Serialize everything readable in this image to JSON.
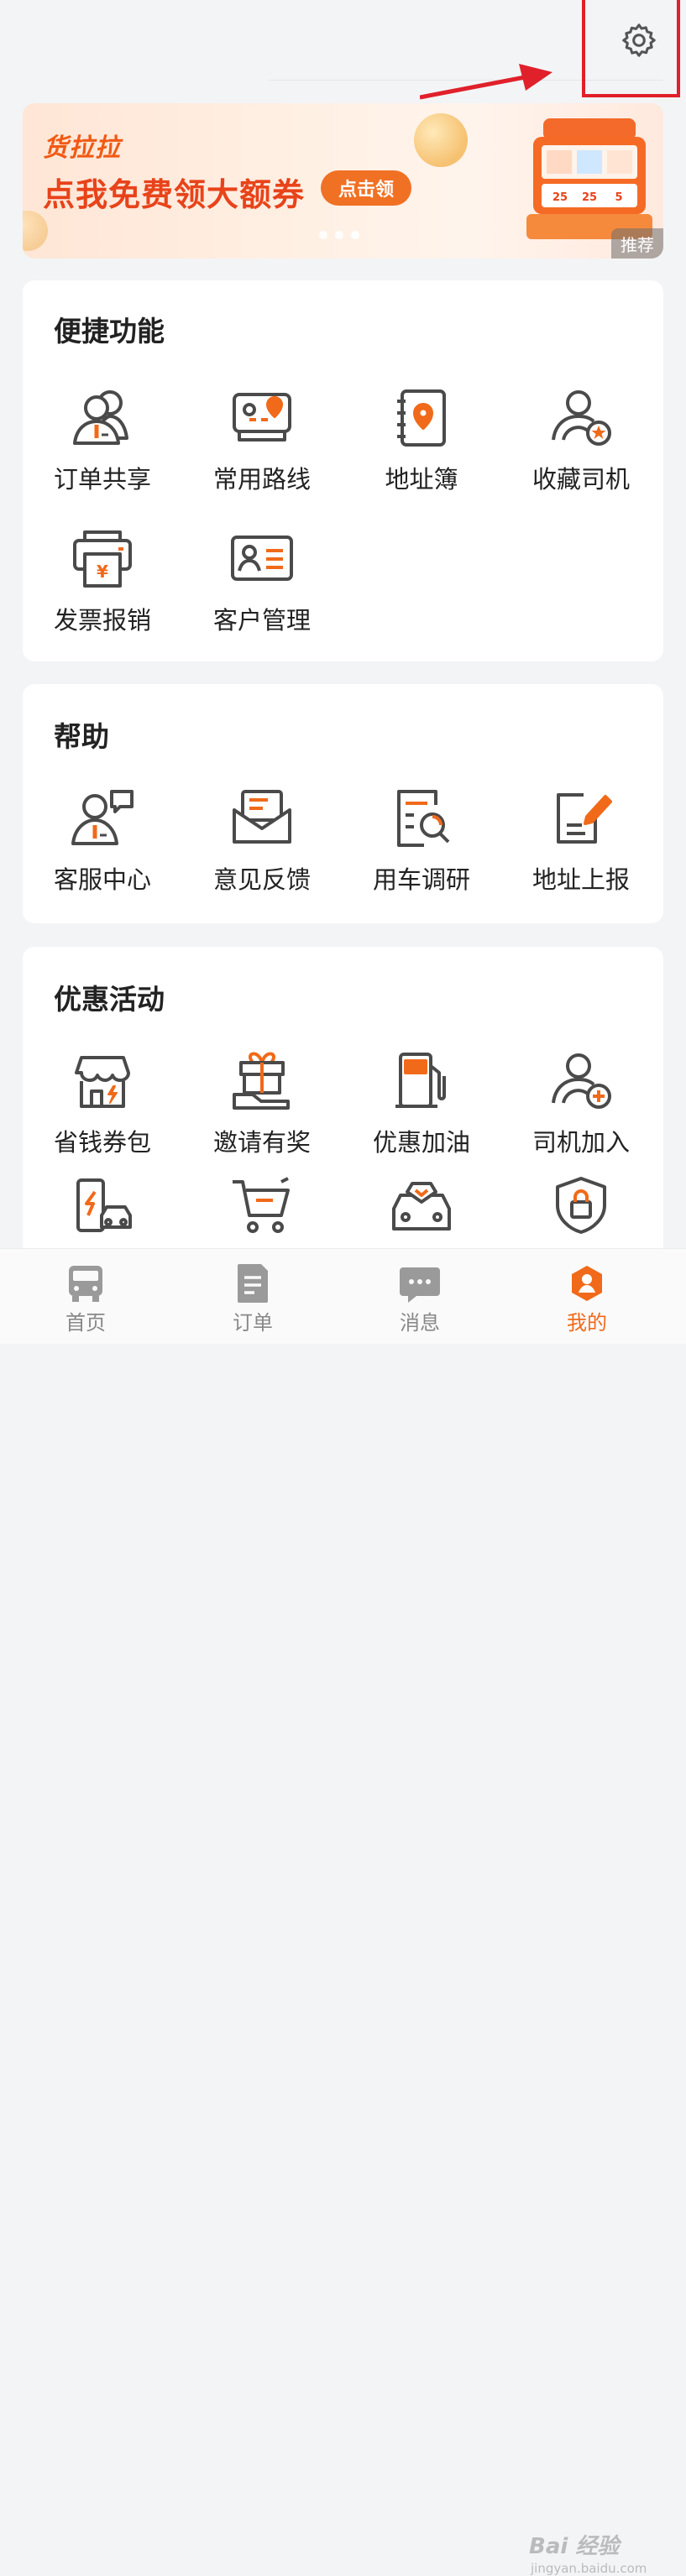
{
  "header": {
    "settings_icon": "gear-icon"
  },
  "banner": {
    "brand": "货拉拉",
    "title": "点我免费领大额券",
    "button": "点击领",
    "tag": "推荐",
    "dots": 3,
    "active_dot": 3,
    "slot_values": [
      "25",
      "25",
      "5"
    ]
  },
  "sections": {
    "quick": {
      "title": "便捷功能",
      "items": [
        {
          "label": "订单共享",
          "icon": "order-share-icon"
        },
        {
          "label": "常用路线",
          "icon": "route-map-icon"
        },
        {
          "label": "地址簿",
          "icon": "address-book-icon"
        },
        {
          "label": "收藏司机",
          "icon": "favorite-driver-icon"
        },
        {
          "label": "发票报销",
          "icon": "invoice-printer-icon"
        },
        {
          "label": "客户管理",
          "icon": "customer-card-icon"
        }
      ]
    },
    "help": {
      "title": "帮助",
      "items": [
        {
          "label": "客服中心",
          "icon": "customer-service-icon"
        },
        {
          "label": "意见反馈",
          "icon": "feedback-mail-icon"
        },
        {
          "label": "用车调研",
          "icon": "survey-search-icon"
        },
        {
          "label": "地址上报",
          "icon": "address-report-icon"
        }
      ]
    },
    "promo": {
      "title": "优惠活动",
      "items": [
        {
          "label": "省钱券包",
          "icon": "coupon-shop-icon"
        },
        {
          "label": "邀请有奖",
          "icon": "gift-invite-icon"
        },
        {
          "label": "优惠加油",
          "icon": "fuel-pump-icon"
        },
        {
          "label": "司机加入",
          "icon": "driver-join-icon"
        },
        {
          "label": "",
          "icon": "charging-car-icon"
        },
        {
          "label": "",
          "icon": "shopping-cart-icon"
        },
        {
          "label": "",
          "icon": "car-heart-icon"
        },
        {
          "label": "",
          "icon": "security-lock-icon"
        }
      ]
    }
  },
  "tabbar": {
    "tabs": [
      {
        "label": "首页",
        "icon": "truck-icon"
      },
      {
        "label": "订单",
        "icon": "order-doc-icon"
      },
      {
        "label": "消息",
        "icon": "message-bubble-icon"
      },
      {
        "label": "我的",
        "icon": "profile-icon",
        "active": true
      }
    ]
  },
  "watermark": {
    "text": "Bai 经验",
    "sub": "jingyan.baidu.com"
  },
  "colors": {
    "accent": "#f06a1a",
    "icon_gray": "#4a4a4a",
    "highlight": "#e0202a"
  }
}
